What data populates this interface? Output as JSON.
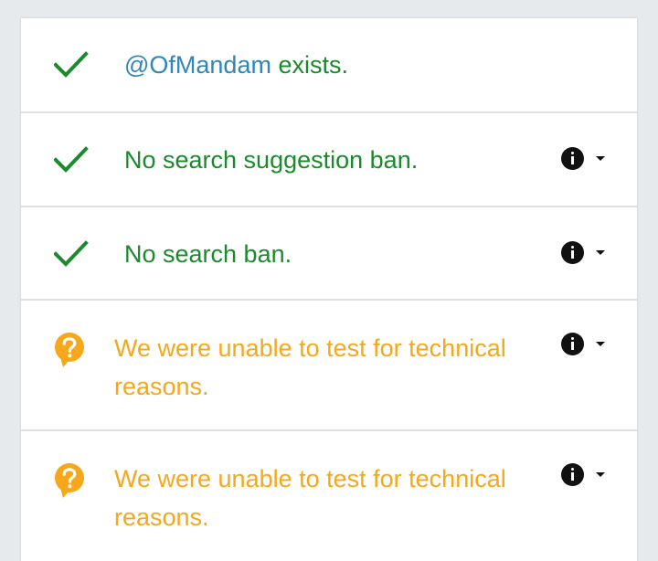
{
  "results": [
    {
      "status": "ok",
      "handle": "@OfMandam",
      "text": " exists.",
      "icon": "check-icon"
    },
    {
      "status": "ok",
      "text": "No search suggestion ban.",
      "icon": "check-icon",
      "controls": [
        "info-icon",
        "caret-down-icon"
      ]
    },
    {
      "status": "ok",
      "text": "No search ban.",
      "icon": "check-icon",
      "controls": [
        "info-icon",
        "caret-down-icon"
      ]
    },
    {
      "status": "unknown",
      "text": "We were unable to test for technical reasons.",
      "icon": "question-icon",
      "controls": [
        "info-icon",
        "caret-down-icon"
      ]
    },
    {
      "status": "unknown",
      "text": "We were unable to test for technical reasons.",
      "icon": "question-icon",
      "controls": [
        "info-icon",
        "caret-down-icon"
      ]
    }
  ],
  "colors": {
    "ok": "#1b8a2c",
    "unknown": "#f6a71a",
    "link": "#2f86b8"
  }
}
